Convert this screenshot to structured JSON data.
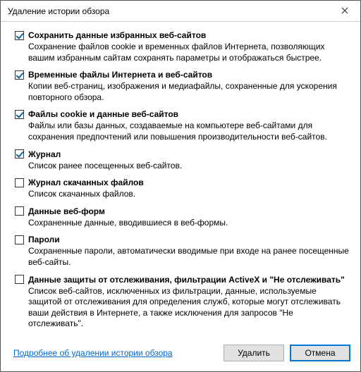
{
  "window": {
    "title": "Удаление истории обзора"
  },
  "items": [
    {
      "checked": true,
      "label": "Сохранить данные избранных веб-сайтов",
      "desc": "Сохранение файлов cookie и временных файлов Интернета, позволяющих вашим избранным сайтам сохранять параметры и отображаться быстрее."
    },
    {
      "checked": true,
      "label": "Временные файлы Интернета и веб-сайтов",
      "desc": "Копии веб-страниц, изображения и медиафайлы, сохраненные для ускорения повторного обзора."
    },
    {
      "checked": true,
      "label": "Файлы cookie и данные веб-сайтов",
      "desc": "Файлы или базы данных, создаваемые на компьютере веб-сайтами для сохранения предпочтений или повышения производительности веб-сайтов."
    },
    {
      "checked": true,
      "label": "Журнал",
      "desc": "Список ранее посещенных веб-сайтов."
    },
    {
      "checked": false,
      "label": "Журнал скачанных файлов",
      "desc": "Список скачанных файлов."
    },
    {
      "checked": false,
      "label": "Данные веб-форм",
      "desc": "Сохраненные данные, вводившиеся в веб-формы."
    },
    {
      "checked": false,
      "label": "Пароли",
      "desc": "Сохраненные пароли, автоматически вводимые при входе на ранее посещенные веб-сайты."
    },
    {
      "checked": false,
      "label": "Данные защиты от отслеживания, фильтрации ActiveX и \"Не отслеживать\"",
      "desc": "Список веб-сайтов, исключенных из фильтрации, данные, используемые защитой от отслеживания для определения служб, которые могут отслеживать ваши действия в Интернете, а также исключения для запросов \"Не отслеживать\"."
    }
  ],
  "footer": {
    "link": "Подробнее об удалении истории обзора",
    "delete": "Удалить",
    "cancel": "Отмена"
  }
}
